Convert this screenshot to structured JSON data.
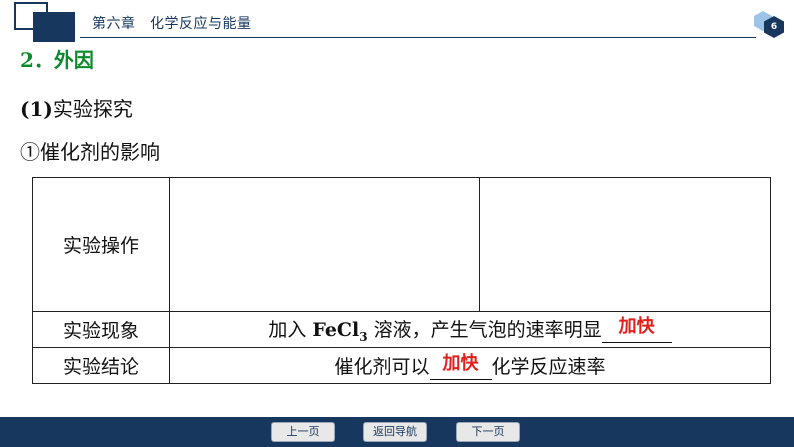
{
  "header": {
    "chapter_title": "第六章　化学反应与能量",
    "page_number": "6",
    "accent_color": "#17375e"
  },
  "content": {
    "heading_number": "2．",
    "heading_text": "外因",
    "sub_label": "(1)",
    "sub_text": "实验探究",
    "item_text": "①催化剂的影响"
  },
  "table": {
    "rows": [
      {
        "label": "实验操作"
      },
      {
        "label": "实验现象",
        "text_before": "加入 ",
        "formula_main": "FeCl",
        "formula_sub": "3",
        "text_after": " 溶液，产生气泡的速率明显",
        "answer": "加快"
      },
      {
        "label": "实验结论",
        "text_before": "催化剂可以",
        "answer": "加快",
        "text_after": "化学反应速率"
      }
    ]
  },
  "footer": {
    "prev_label": "上一页",
    "back_label": "返回导航",
    "next_label": "下一页"
  }
}
